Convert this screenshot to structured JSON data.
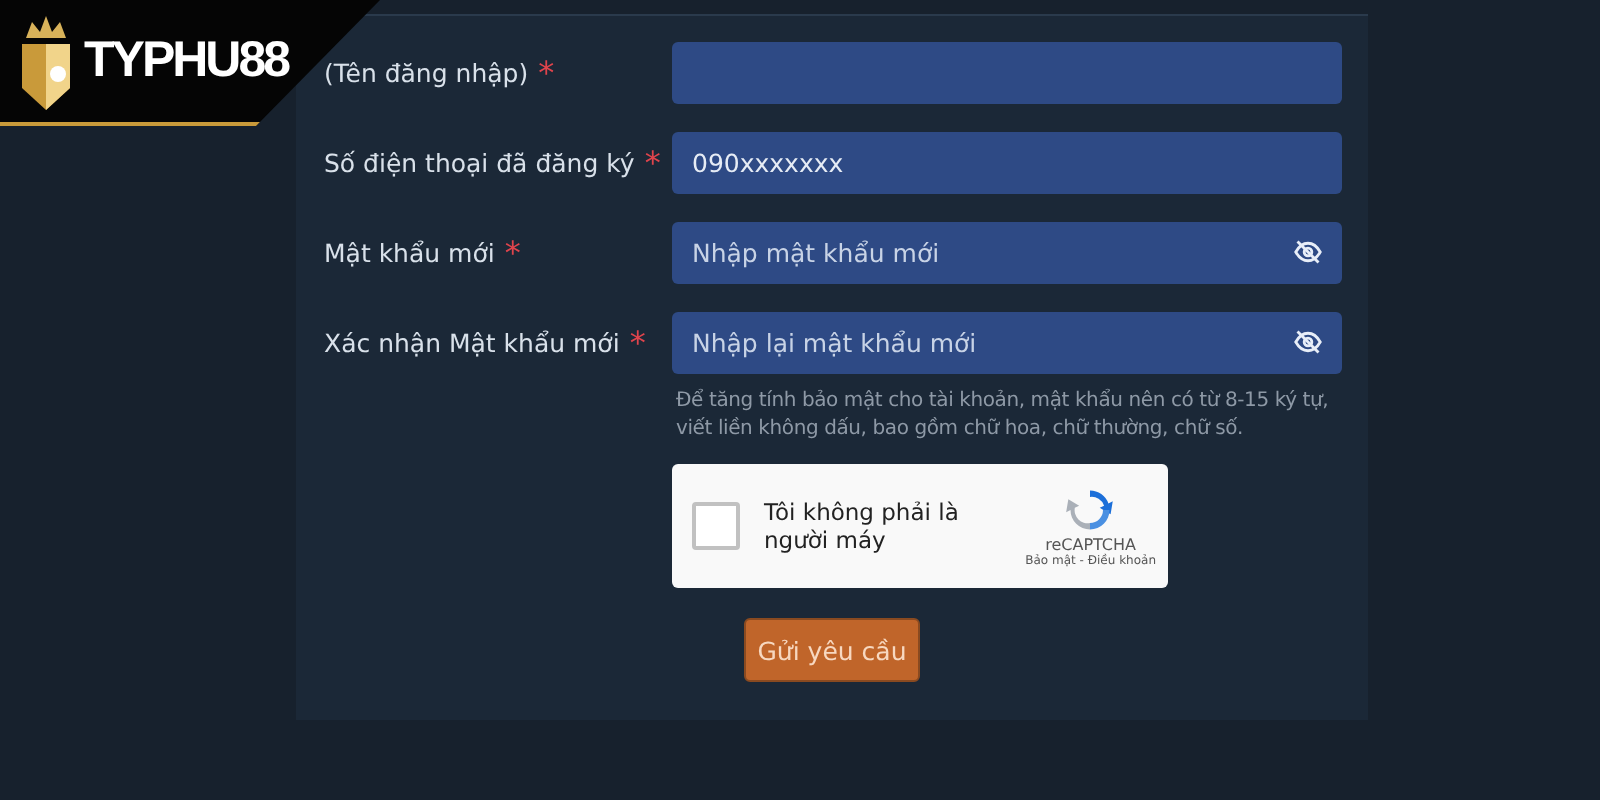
{
  "logo": {
    "text": "TYPHU88"
  },
  "fields": [
    {
      "label": "(Tên đăng nhập)",
      "required_mark": "*",
      "kind": "text"
    },
    {
      "label": "Số điện thoại đã đăng ký",
      "required_mark": "*",
      "kind": "text",
      "value": "090xxxxxxx"
    },
    {
      "label": "Mật khẩu mới",
      "required_mark": "*",
      "kind": "password",
      "placeholder": "Nhập mật khẩu mới"
    },
    {
      "label": "Xác nhận Mật khẩu mới",
      "required_mark": "*",
      "kind": "password",
      "placeholder": "Nhập lại mật khẩu mới"
    }
  ],
  "hint": "Để tăng tính bảo mật cho tài khoản, mật khẩu nên có từ 8-15 ký tự, viết liền không dấu, bao gồm chữ hoa, chữ thường, chữ số.",
  "captcha": {
    "label": "Tôi không phải là người máy",
    "checked": false,
    "brand": "reCAPTCHA",
    "links": "Bảo mật - Điều khoản"
  },
  "submit": "Gửi yêu cầu"
}
